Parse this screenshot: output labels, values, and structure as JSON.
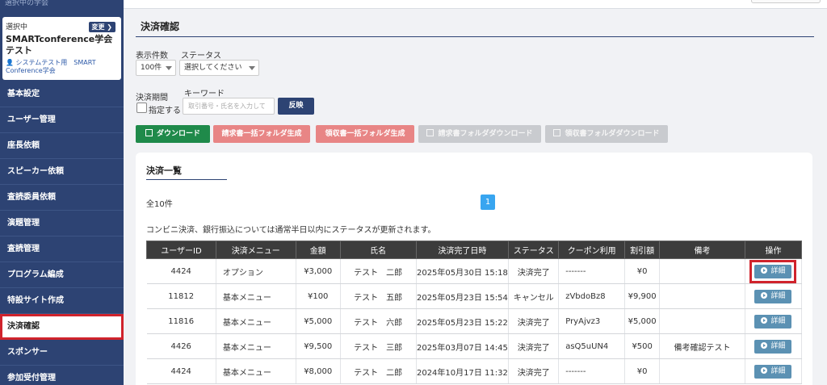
{
  "sidebar": {
    "top_text": "選択中の学会",
    "selected_label": "選択中",
    "change_label": "変更 ❯",
    "conference_name": "SMARTconference学会　テスト",
    "user_name": "システムテスト用　SMART Conference学会",
    "items": [
      {
        "label": "基本設定"
      },
      {
        "label": "ユーザー管理"
      },
      {
        "label": "座長依頼"
      },
      {
        "label": "スピーカー依頼"
      },
      {
        "label": "査読委員依頼"
      },
      {
        "label": "演題管理"
      },
      {
        "label": "査読管理"
      },
      {
        "label": "プログラム編成"
      },
      {
        "label": "特設サイト作成"
      },
      {
        "label": "決済確認",
        "active": true
      },
      {
        "label": "スポンサー"
      },
      {
        "label": "参加受付管理"
      }
    ]
  },
  "main": {
    "title": "決済確認",
    "filters": {
      "count_label": "表示件数",
      "count_value": "100件",
      "status_label": "ステータス",
      "status_value": "選択してください",
      "period_label": "決済期間",
      "specify_label": "指定する",
      "keyword_label": "キーワード",
      "keyword_placeholder": "取引番号・氏名を入力して",
      "apply_label": "反映"
    },
    "actions": {
      "download": "ダウンロード",
      "invoice_bulk": "請求書一括フォルダ生成",
      "receipt_bulk": "領収書一括フォルダ生成",
      "invoice_download": "請求書フォルダダウンロード",
      "receipt_download": "領収書フォルダダウンロード"
    },
    "list": {
      "title": "決済一覧",
      "total": "全10件",
      "page": "1",
      "notice": "コンビニ決済、銀行振込については通常半日以内にステータスが更新されます。",
      "columns": [
        "ユーザーID",
        "決済メニュー",
        "金額",
        "氏名",
        "決済完了日時",
        "ステータス",
        "クーポン利用",
        "割引額",
        "備考",
        "操作"
      ],
      "detail_label": "詳細",
      "rows": [
        {
          "id": "4424",
          "menu": "オプション",
          "amount": "¥3,000",
          "name": "テスト　二郎",
          "date": "2025年05月30日 15:18",
          "status": "決済完了",
          "coupon": "-------",
          "discount": "¥0",
          "note": ""
        },
        {
          "id": "11812",
          "menu": "基本メニュー",
          "amount": "¥100",
          "name": "テスト　五郎",
          "date": "2025年05月23日 15:54",
          "status": "キャンセル",
          "coupon": "zVbdoBz8",
          "discount": "¥9,900",
          "note": ""
        },
        {
          "id": "11816",
          "menu": "基本メニュー",
          "amount": "¥5,000",
          "name": "テスト　六郎",
          "date": "2025年05月23日 15:22",
          "status": "決済完了",
          "coupon": "PryAjvz3",
          "discount": "¥5,000",
          "note": ""
        },
        {
          "id": "4426",
          "menu": "基本メニュー",
          "amount": "¥9,500",
          "name": "テスト　三郎",
          "date": "2025年03月07日 14:45",
          "status": "決済完了",
          "coupon": "asQ5uUN4",
          "discount": "¥500",
          "note": "備考確認テスト"
        },
        {
          "id": "4424",
          "menu": "基本メニュー",
          "amount": "¥8,000",
          "name": "テスト　二郎",
          "date": "2024年10月17日 11:32",
          "status": "決済完了",
          "coupon": "-------",
          "discount": "¥0",
          "note": ""
        }
      ]
    }
  },
  "colors": {
    "sidebar_bg": "#2d4373",
    "highlight": "#d0232c",
    "download_green": "#1f8a4a",
    "bulk_red": "#e88585",
    "detail_blue": "#5b91b3",
    "page_blue": "#38a5f0"
  }
}
